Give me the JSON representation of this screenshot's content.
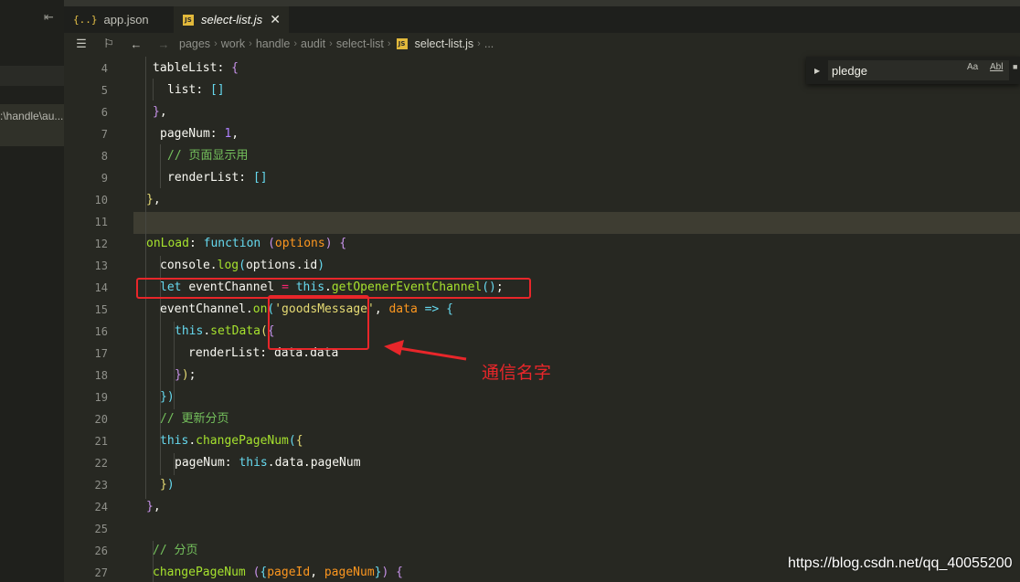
{
  "sidebar": {
    "path_fragment": ":\\handle\\au..."
  },
  "tabs": [
    {
      "label": "app.json",
      "icon": "{..}"
    },
    {
      "label": "select-list.js",
      "icon": "JS",
      "close": "✕"
    }
  ],
  "breadcrumb": {
    "segments": [
      "pages",
      "work",
      "handle",
      "audit",
      "select-list"
    ],
    "file": "select-list.js",
    "tail": "...",
    "file_icon": "JS"
  },
  "find": {
    "value": "pledge",
    "opt_case": "Aa",
    "opt_word": "Abl"
  },
  "editor": {
    "line_numbers": [
      "4",
      "5",
      "6",
      "7",
      "8",
      "9",
      "10",
      "11",
      "12",
      "13",
      "14",
      "15",
      "16",
      "17",
      "18",
      "19",
      "20",
      "21",
      "22",
      "23",
      "24",
      "25",
      "26",
      "27"
    ],
    "comment_page_display": "// 页面显示用",
    "comment_update_paging": "// 更新分页",
    "comment_paging": "// 分页",
    "event_name": "'goodsMessage'"
  },
  "annotation": {
    "text": "通信名字",
    "color": "#e8262a"
  },
  "watermark": "https://blog.csdn.net/qq_40055200",
  "colors": {
    "background": "#272822",
    "keyword": "#66d9ef",
    "function": "#a6e22e",
    "string": "#e6db74",
    "number": "#ae81ff",
    "annotation": "#e8262a"
  }
}
